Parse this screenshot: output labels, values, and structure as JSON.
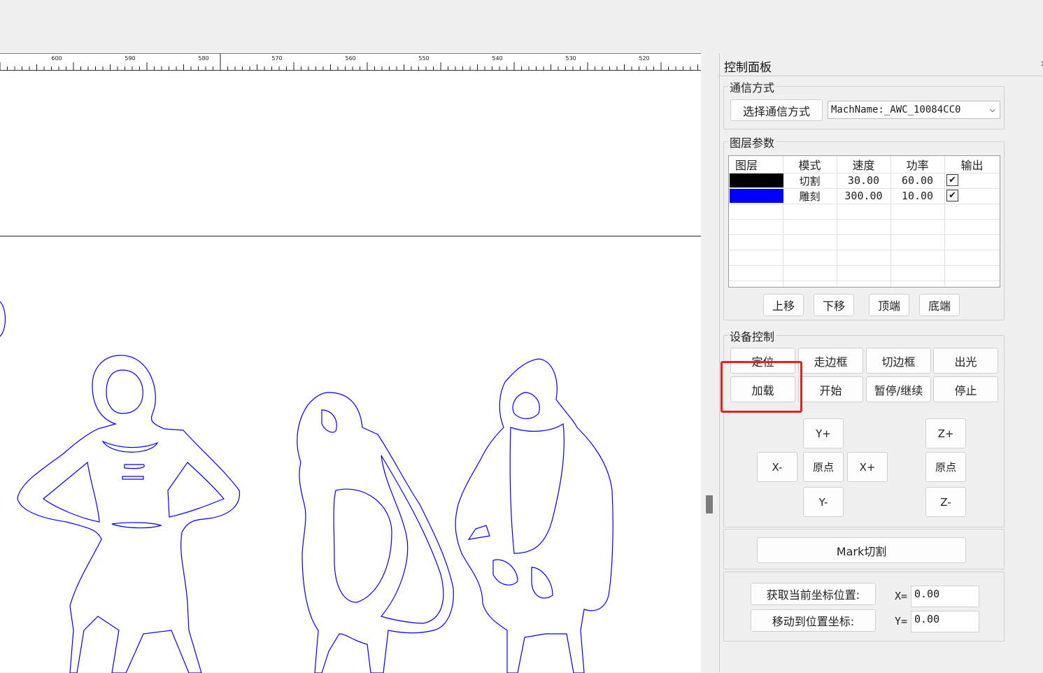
{
  "ruler": {
    "labels": [
      "600",
      "590",
      "580",
      "570",
      "560",
      "550",
      "540",
      "530",
      "520"
    ]
  },
  "panel": {
    "title": "控制面板",
    "close_glyph": "×",
    "comm": {
      "title": "通信方式",
      "select_button": "选择通信方式",
      "machine_value": "MachName:_AWC_10084CC0",
      "dropdown_glyph": "⌵"
    },
    "layers": {
      "title": "图层参数",
      "headers": [
        "图层",
        "模式",
        "速度",
        "功率",
        "输出"
      ],
      "rows": [
        {
          "color": "#000000",
          "mode": "切割",
          "speed": "30.00",
          "power": "60.00",
          "output": "✔"
        },
        {
          "color": "#0000ff",
          "mode": "雕刻",
          "speed": "300.00",
          "power": "10.00",
          "output": "✔"
        }
      ],
      "buttons": [
        "上移",
        "下移",
        "顶端",
        "底端"
      ]
    },
    "device": {
      "title": "设备控制",
      "row1": [
        "定位",
        "走边框",
        "切边框",
        "出光"
      ],
      "row2": [
        "加载",
        "开始",
        "暂停/继续",
        "停止"
      ],
      "jog": {
        "y_plus": "Y+",
        "x_minus": "X-",
        "origin": "原点",
        "x_plus": "X+",
        "y_minus": "Y-",
        "z_plus": "Z+",
        "z_origin": "原点",
        "z_minus": "Z-"
      }
    },
    "mark_cut": "Mark切割",
    "coords": {
      "get_button": "获取当前坐标位置:",
      "move_button": "移动到位置坐标:",
      "x_label": "X=",
      "y_label": "Y=",
      "x_value": "0.00",
      "y_value": "0.00"
    }
  },
  "colors": {
    "highlight": "#e8201f",
    "outline": "#0000ff"
  }
}
